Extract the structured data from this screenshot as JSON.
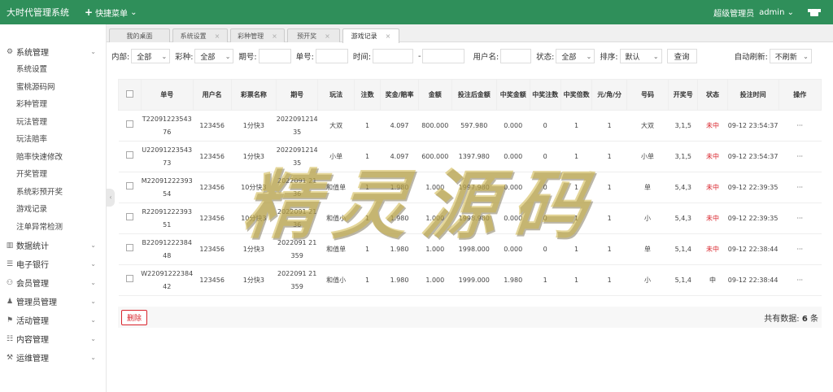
{
  "app": {
    "title": "大时代管理系统",
    "quick_menu": "快捷菜单",
    "user_role": "超级管理员",
    "username": "admin"
  },
  "sidebar": {
    "groups": [
      {
        "label": "系统管理",
        "expanded": true,
        "items": [
          "系统设置",
          "蜜桃源码网",
          "彩种管理",
          "玩法管理",
          "玩法赔率",
          "赔率快速修改",
          "开奖管理",
          "系统彩预开奖",
          "游戏记录",
          "注单异常检测"
        ]
      },
      {
        "label": "数据统计"
      },
      {
        "label": "电子银行"
      },
      {
        "label": "会员管理"
      },
      {
        "label": "管理员管理"
      },
      {
        "label": "活动管理"
      },
      {
        "label": "内容管理"
      },
      {
        "label": "运维管理"
      }
    ]
  },
  "tabs": [
    {
      "label": "我的桌面",
      "closable": false,
      "active": false
    },
    {
      "label": "系统设置",
      "closable": true,
      "active": false
    },
    {
      "label": "彩种管理",
      "closable": true,
      "active": false
    },
    {
      "label": "预开奖",
      "closable": true,
      "active": false
    },
    {
      "label": "游戏记录",
      "closable": true,
      "active": true
    }
  ],
  "filters": {
    "internal_label": "内部:",
    "internal_value": "全部",
    "lottery_label": "彩种:",
    "lottery_value": "全部",
    "issue_label": "期号:",
    "bet_no_label": "单号:",
    "time_label": "时间:",
    "time_sep": "-",
    "username_label": "用户名:",
    "status_label": "状态:",
    "status_value": "全部",
    "sort_label": "排序:",
    "sort_value": "默认",
    "query_button": "查询",
    "auto_refresh_label": "自动刷新:",
    "auto_refresh_value": "不刷新"
  },
  "table": {
    "headers": [
      "单号",
      "用户名",
      "彩票名称",
      "期号",
      "玩法",
      "注数",
      "奖金/赔率",
      "金额",
      "投注后金额",
      "中奖金额",
      "中奖注数",
      "中奖倍数",
      "元/角/分",
      "号码",
      "开奖号",
      "状态",
      "投注时间",
      "操作"
    ],
    "rows": [
      [
        "T2209122354376",
        "123456",
        "1分快3",
        "2022091214 35",
        "大双",
        "1",
        "4.097",
        "800.000",
        "597.980",
        "0.000",
        "0",
        "1",
        "1",
        "大双",
        "3,1,5",
        "未中",
        "09-12 23:54:37",
        "···"
      ],
      [
        "U2209122354373",
        "123456",
        "1分快3",
        "2022091214 35",
        "小单",
        "1",
        "4.097",
        "600.000",
        "1397.980",
        "0.000",
        "0",
        "1",
        "1",
        "小单",
        "3,1,5",
        "未中",
        "09-12 23:54:37",
        "···"
      ],
      [
        "M2209122239354",
        "123456",
        "10分快3",
        "2022091 2136",
        "和值单",
        "1",
        "1.980",
        "1.000",
        "1997.980",
        "0.000",
        "0",
        "1",
        "1",
        "单",
        "5,4,3",
        "未中",
        "09-12 22:39:35",
        "···"
      ],
      [
        "R2209122239351",
        "123456",
        "10分快3",
        "2022091 2136",
        "和值小",
        "1",
        "1.980",
        "1.000",
        "1998.980",
        "0.000",
        "0",
        "1",
        "1",
        "小",
        "5,4,3",
        "未中",
        "09-12 22:39:35",
        "···"
      ],
      [
        "B2209122238448",
        "123456",
        "1分快3",
        "2022091 21359",
        "和值单",
        "1",
        "1.980",
        "1.000",
        "1998.000",
        "0.000",
        "0",
        "1",
        "1",
        "单",
        "5,1,4",
        "未中",
        "09-12 22:38:44",
        "···"
      ],
      [
        "W2209122238442",
        "123456",
        "1分快3",
        "2022091 21359",
        "和值小",
        "1",
        "1.980",
        "1.000",
        "1999.000",
        "1.980",
        "1",
        "1",
        "1",
        "小",
        "5,1,4",
        "中",
        "09-12 22:38:44",
        "···"
      ]
    ]
  },
  "footer": {
    "delete_button": "删除",
    "total_label": "共有数据:",
    "total_count": "6",
    "total_unit": "条"
  },
  "watermark": "精灵源码",
  "colors": {
    "topbar": "#2f8f5a",
    "lost_status": "#d9232b"
  }
}
